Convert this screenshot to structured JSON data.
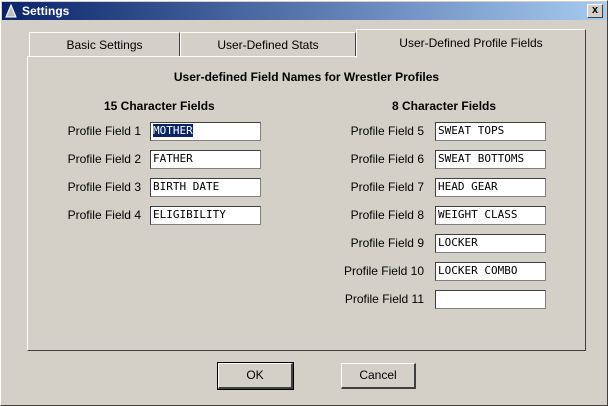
{
  "window": {
    "title": "Settings",
    "close_label": "x"
  },
  "tabs": [
    {
      "label": "Basic Settings"
    },
    {
      "label": "User-Defined Stats"
    },
    {
      "label": "User-Defined Profile Fields",
      "active": true
    }
  ],
  "panel": {
    "heading": "User-defined Field Names for Wrestler Profiles",
    "left_heading": "15 Character Fields",
    "right_heading": "8 Character Fields",
    "left_fields": [
      {
        "label": "Profile Field 1",
        "value": "MOTHER"
      },
      {
        "label": "Profile Field 2",
        "value": "FATHER"
      },
      {
        "label": "Profile Field 3",
        "value": "BIRTH DATE"
      },
      {
        "label": "Profile Field 4",
        "value": "ELIGIBILITY"
      }
    ],
    "right_fields": [
      {
        "label": "Profile Field 5",
        "value": "SWEAT TOPS"
      },
      {
        "label": "Profile Field 6",
        "value": "SWEAT BOTTOMS"
      },
      {
        "label": "Profile Field 7",
        "value": "HEAD GEAR"
      },
      {
        "label": "Profile Field 8",
        "value": "WEIGHT CLASS"
      },
      {
        "label": "Profile Field 9",
        "value": "LOCKER"
      },
      {
        "label": "Profile Field 10",
        "value": "LOCKER COMBO"
      },
      {
        "label": "Profile Field 11",
        "value": ""
      }
    ]
  },
  "buttons": {
    "ok": "OK",
    "cancel": "Cancel"
  }
}
